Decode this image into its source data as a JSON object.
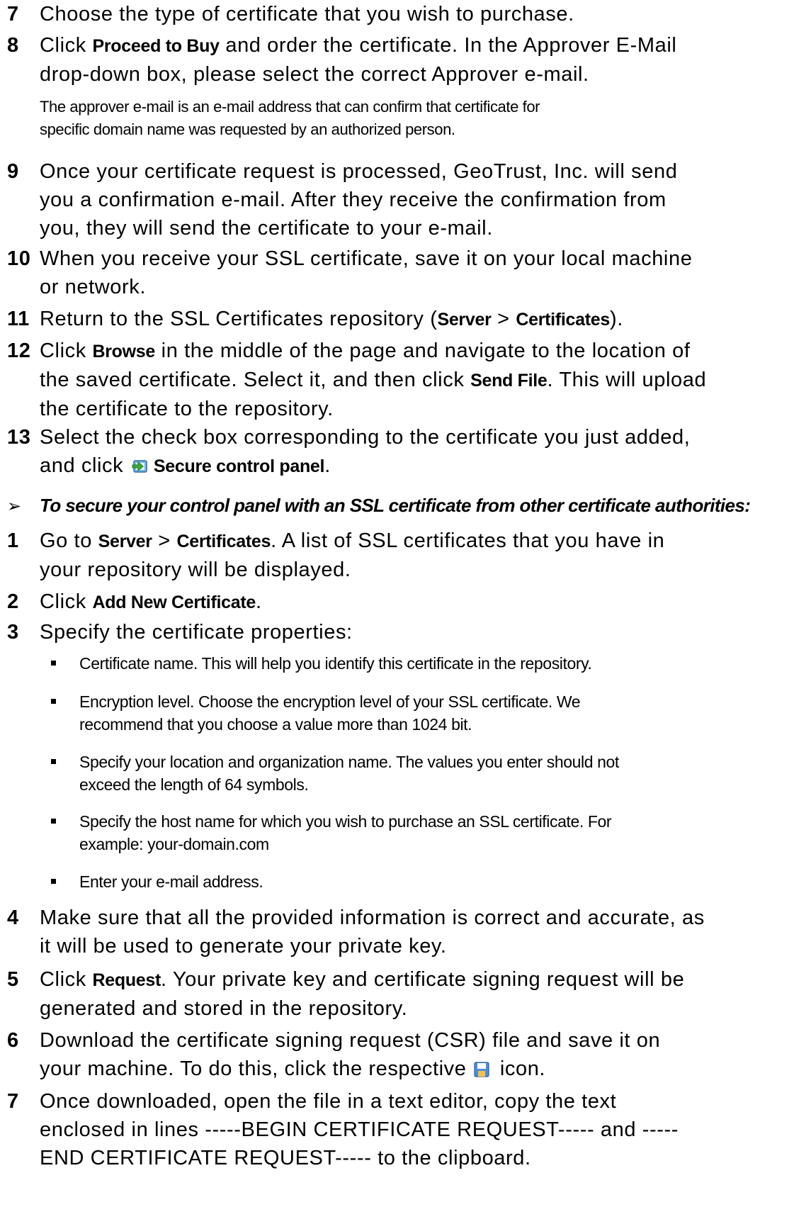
{
  "steps_top": [
    {
      "num": "7",
      "lines": [
        "Choose the type of certificate that you wish to purchase."
      ]
    },
    {
      "num": "8",
      "pre": "Click ",
      "bold": "Proceed to Buy",
      "post": " and order the certificate. In the Approver E-Mail",
      "line2": "drop-down box, please select the correct Approver e-mail."
    },
    {
      "note": [
        "The approver e-mail is an e-mail address that can confirm that certificate for",
        "specific domain name was requested by an authorized person."
      ]
    },
    {
      "num": "9",
      "lines": [
        "Once your certificate request is processed, GeoTrust, Inc. will send",
        "you a confirmation e-mail. After they receive the confirmation from",
        "you, they will send the certificate to your e-mail."
      ]
    },
    {
      "num": "10",
      "lines": [
        "When you receive your SSL certificate, save it on your local machine",
        "or network."
      ]
    },
    {
      "num": "11",
      "pre": "Return to the SSL Certificates repository (",
      "b1": "Server",
      "mid": " > ",
      "b2": "Certificates",
      "post": ")."
    },
    {
      "num": "12",
      "pre": "Click ",
      "bold": "Browse",
      "post": " in the middle of the page and navigate to the location of",
      "line2": "the saved certificate. Select it, and then click ",
      "bold2": "Send File",
      "post2": ". This will upload",
      "line3": "the certificate to the repository."
    },
    {
      "num": "13",
      "pre": "Select the check box corresponding to the certificate you just added,",
      "line2": "and click ",
      "bold2": "Secure control panel",
      "post2": "."
    }
  ],
  "heading": {
    "arrow": "➢",
    "text": "To secure your control panel with an SSL certificate from other certificate authorities:"
  },
  "steps_bottom": [
    {
      "num": "1",
      "pre": "Go to ",
      "b1": "Server",
      "mid": " > ",
      "b2": "Certificates",
      "post": ". A list of SSL certificates that you have in",
      "line2": "your repository will be displayed."
    },
    {
      "num": "2",
      "pre": "Click ",
      "bold": "Add New Certificate",
      "post": "."
    },
    {
      "num": "3",
      "text": "Specify the certificate properties:"
    },
    {
      "num": "4",
      "lines": [
        "Make sure that all the provided information is correct and accurate, as",
        "it will be used to generate your private key."
      ]
    },
    {
      "num": "5",
      "pre": "Click ",
      "bold": "Request",
      "post": ". Your private key and certificate signing request will be",
      "line2": "generated and stored in the repository."
    },
    {
      "num": "6",
      "text": "Download the certificate signing request (CSR) file and save it on",
      "line2pre": "your machine. To do this, click the respective ",
      "line2post": " icon."
    },
    {
      "num": "7",
      "lines": [
        "Once downloaded, open the file in a text editor, copy the text",
        "enclosed in lines -----BEGIN CERTIFICATE REQUEST----- and -----",
        "END CERTIFICATE REQUEST----- to the clipboard."
      ]
    }
  ],
  "bullets": [
    [
      "Certificate name. This will help you identify this certificate in the repository."
    ],
    [
      "Encryption level. Choose the encryption level of your SSL certificate. We",
      "recommend that you choose a value more than 1024 bit."
    ],
    [
      "Specify your location and organization name. The values you enter should not",
      "exceed the length of 64 symbols."
    ],
    [
      "Specify the host name for which you wish to purchase an SSL certificate. For",
      "example: your-domain.com"
    ],
    [
      "Enter your e-mail address."
    ]
  ],
  "icons": {
    "secure_panel": "secure-panel-icon",
    "save": "save-icon"
  }
}
